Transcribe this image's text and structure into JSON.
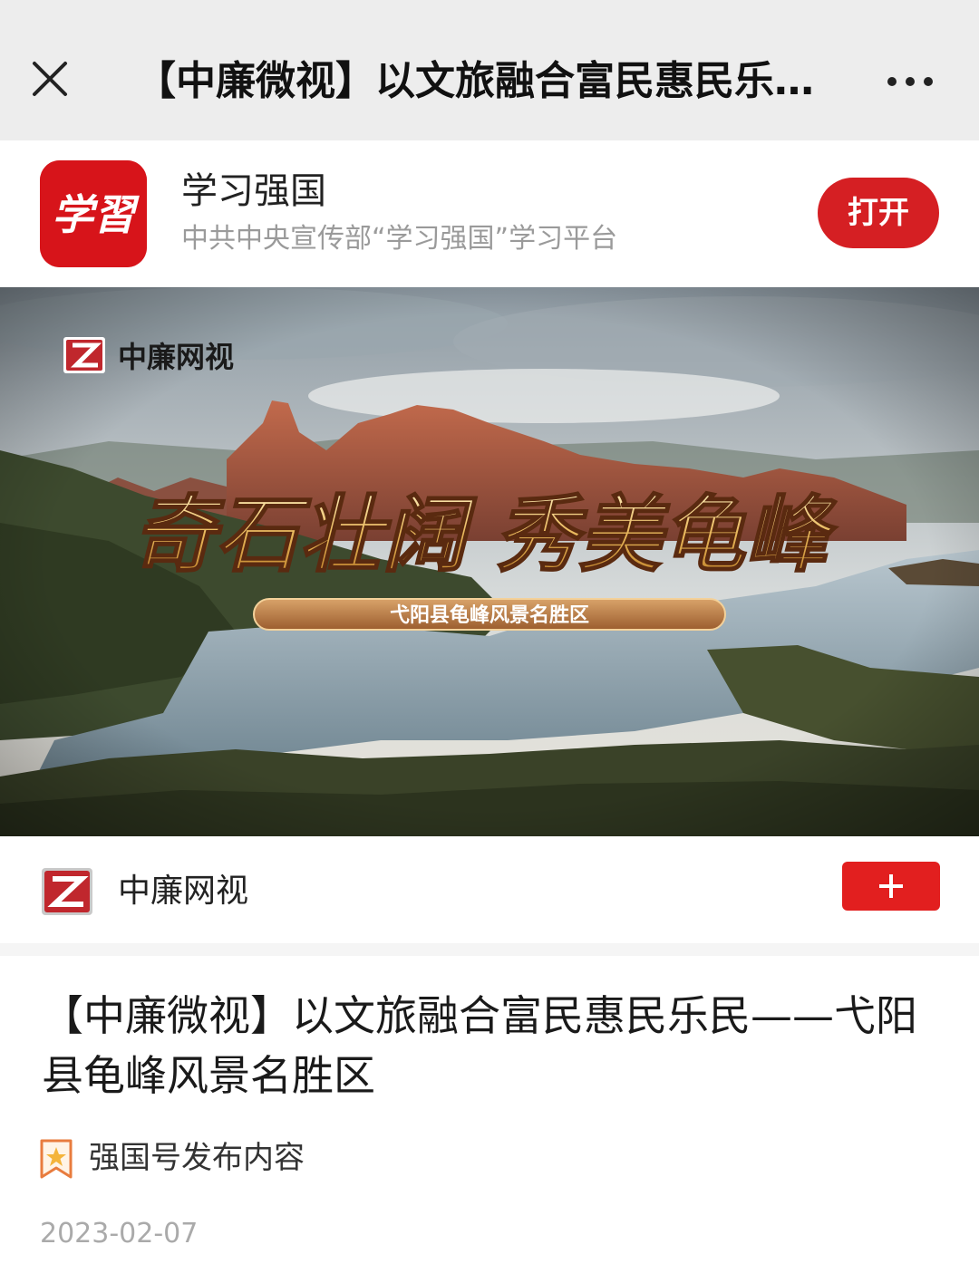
{
  "nav": {
    "title": "【中廉微视】以文旅融合富民惠民乐…",
    "close_icon": "close-icon",
    "more_icon": "more-dots-icon"
  },
  "app_banner": {
    "logo_text": "学習",
    "name": "学习强国",
    "description": "中共中央宣传部“学习强国”学习平台",
    "open_label": "打开",
    "accent": "#d51f23"
  },
  "cover": {
    "watermark": "中廉网视",
    "headline": "奇石壮阔 秀美龟峰",
    "ribbon": "弋阳县龟峰风景名胜区"
  },
  "channel": {
    "name": "中廉网视",
    "follow_label": "+",
    "follow_color": "#e21f1f"
  },
  "article": {
    "title": "【中廉微视】以文旅融合富民惠民乐民——弋阳县龟峰风景名胜区",
    "source": "强国号发布内容",
    "date": "2023-02-07"
  }
}
